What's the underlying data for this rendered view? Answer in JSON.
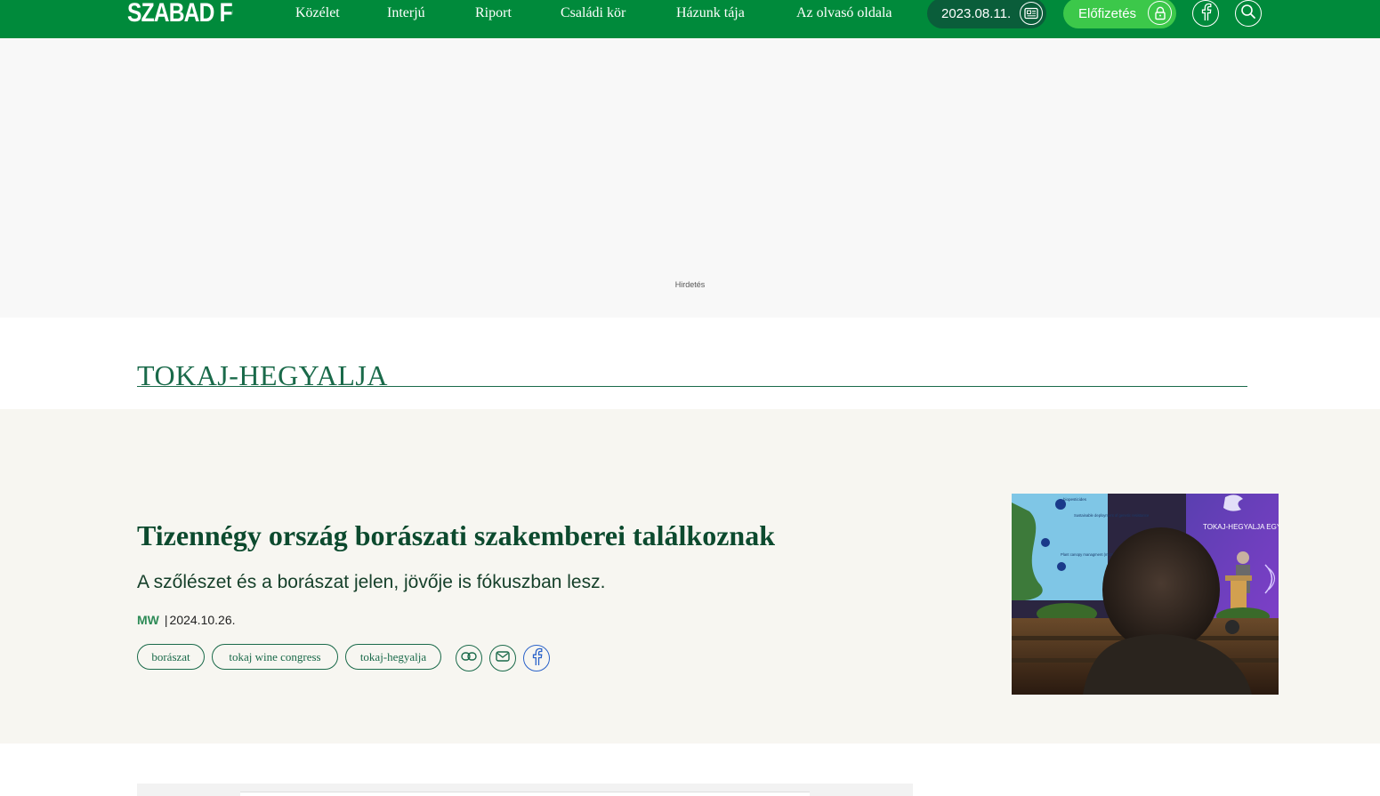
{
  "header": {
    "logo": "SZABAD FÖLD",
    "nav": [
      "Közélet",
      "Interjú",
      "Riport",
      "Családi kör",
      "Házunk tája",
      "Az olvasó oldala"
    ],
    "issue_date": "2023.08.11.",
    "subscribe": "Előfizetés",
    "icons": {
      "issue": "newspaper-icon",
      "subscribe": "lock-icon",
      "social": "facebook-icon",
      "search": "search-icon"
    }
  },
  "ad": {
    "label": "Hirdetés"
  },
  "tag_page": {
    "title": "TOKAJ-HEGYALJA"
  },
  "article": {
    "headline": "Tizennégy ország borászati szakemberei találkoznak",
    "lead": "A szőlészet és a borászat jelen, jövője is fókuszban lesz.",
    "author": "MW",
    "separator": "|",
    "date": "2024.10.26.",
    "tags": [
      "borászat",
      "tokaj wine congress",
      "tokaj-hegyalja"
    ],
    "share_icons": [
      "link-icon",
      "mail-icon",
      "facebook-icon"
    ],
    "photo": {
      "slide_texts": [
        "biopesticides",
        "Sustainable deployment of genetic resistance",
        "Plant canopy managment (microbiota physiology) x environment"
      ],
      "screen_brand": "TOKAJ-HEGYALJA EGYETEM"
    }
  },
  "colors": {
    "brand_green": "#008a3b",
    "dark_green": "#0c4a2e",
    "accent_green": "#3cc84a",
    "band_bg": "#f7f6f1"
  }
}
